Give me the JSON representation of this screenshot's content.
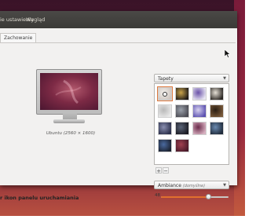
{
  "window": {
    "menus": [
      "ie ustawienia",
      "Wygląd"
    ]
  },
  "tabs": [
    "Zachowanie"
  ],
  "preview": {
    "resolution": "Ubuntu (2560 × 1600)"
  },
  "background_source": {
    "selected": "Tapety",
    "arrow": "▼"
  },
  "wallpapers": [
    {
      "name": "wallpaper-1",
      "colors": [
        "#cfc6c0",
        "#f1eeea"
      ],
      "selected": true
    },
    {
      "name": "wallpaper-2",
      "colors": [
        "#1f1b18",
        "#c9a34a"
      ]
    },
    {
      "name": "wallpaper-3",
      "colors": [
        "#e8e6f2",
        "#6a52a8"
      ]
    },
    {
      "name": "wallpaper-4",
      "colors": [
        "#2a2622",
        "#e6e0d6"
      ]
    },
    {
      "name": "wallpaper-5",
      "colors": [
        "#e9e9e9",
        "#b8b8b8"
      ]
    },
    {
      "name": "wallpaper-6",
      "colors": [
        "#4a4a52",
        "#9aa0aa"
      ]
    },
    {
      "name": "wallpaper-7",
      "colors": [
        "#5a4fb0",
        "#d7d2ee"
      ]
    },
    {
      "name": "wallpaper-8",
      "colors": [
        "#7a5a3a",
        "#2a1e14"
      ]
    },
    {
      "name": "wallpaper-9",
      "colors": [
        "#2b2f4a",
        "#8a8fb0"
      ]
    },
    {
      "name": "wallpaper-10",
      "colors": [
        "#1a1a22",
        "#5a6478"
      ]
    },
    {
      "name": "wallpaper-11",
      "colors": [
        "#d7b0c0",
        "#6a2a4a"
      ]
    },
    {
      "name": "wallpaper-12",
      "colors": [
        "#1f2a3a",
        "#6a8ab0"
      ]
    },
    {
      "name": "wallpaper-13",
      "colors": [
        "#1c2230",
        "#4a6aa0"
      ]
    },
    {
      "name": "wallpaper-14",
      "colors": [
        "#4a1a2a",
        "#a04050"
      ]
    }
  ],
  "gallery_buttons": {
    "add": "+",
    "remove": "−"
  },
  "theme": {
    "name": "Ambiance",
    "note": "(domyślne)",
    "arrow": "▼"
  },
  "launcher_icon_size": {
    "label": "r ikon panelu uruchamiania",
    "value": "48",
    "min": 16,
    "max": 64,
    "fraction": 0.7
  },
  "colors": {
    "accent": "#e0702e",
    "menubar": "#3b3a37"
  }
}
